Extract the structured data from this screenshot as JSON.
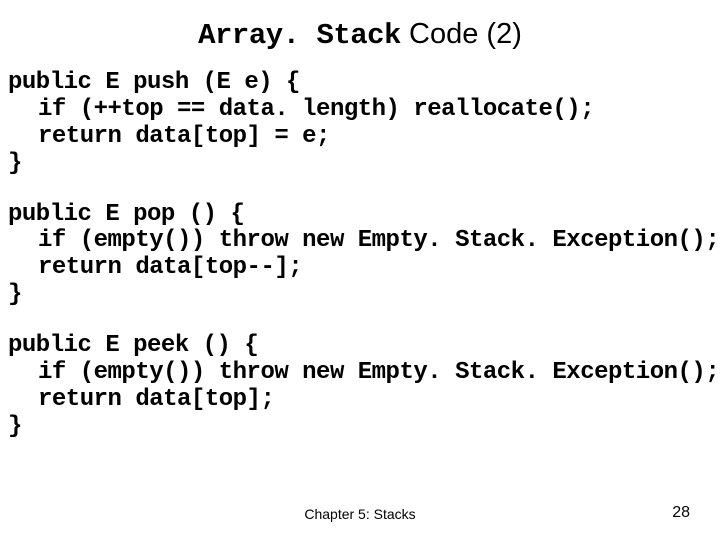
{
  "title": {
    "mono": "Array. Stack",
    "rest": " Code (2)"
  },
  "code": {
    "block1": {
      "l1": "public E push (E e) {",
      "l2": "if (++top == data. length) reallocate();",
      "l3": "return data[top] = e;",
      "l4": "}"
    },
    "block2": {
      "l1": "public E pop () {",
      "l2": "if (empty()) throw new Empty. Stack. Exception();",
      "l3": "return data[top--];",
      "l4": "}"
    },
    "block3": {
      "l1": "public E peek () {",
      "l2": "if (empty()) throw new Empty. Stack. Exception();",
      "l3": "return data[top];",
      "l4": "}"
    }
  },
  "footer": {
    "chapter": "Chapter 5: Stacks",
    "page": "28"
  }
}
